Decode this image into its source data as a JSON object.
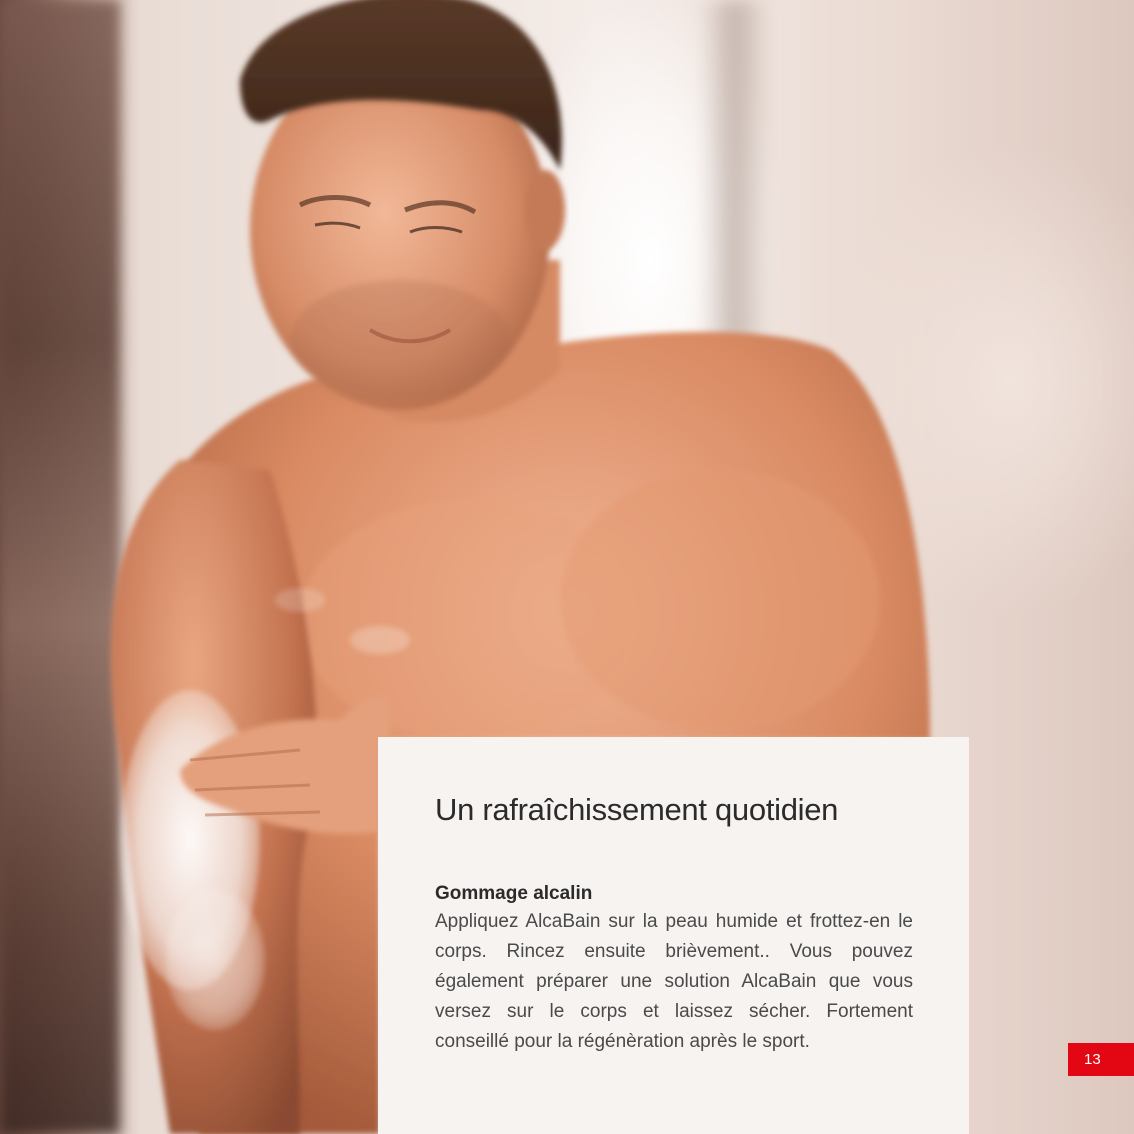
{
  "card": {
    "title": "Un rafraîchissement quotidien",
    "subtitle": "Gommage alcalin",
    "body": "Appliquez AlcaBain sur la peau humide et frottez-en le corps. Rincez ensuite brièvement.. Vous pouvez également préparer une solution AlcaBain que vous versez sur le corps et laissez sécher. Fortement conseillé pour la régénèration après le sport."
  },
  "page_number": "13",
  "colors": {
    "accent": "#e30613",
    "card_background": "#f7f3f1",
    "text": "#2b2b2b"
  }
}
